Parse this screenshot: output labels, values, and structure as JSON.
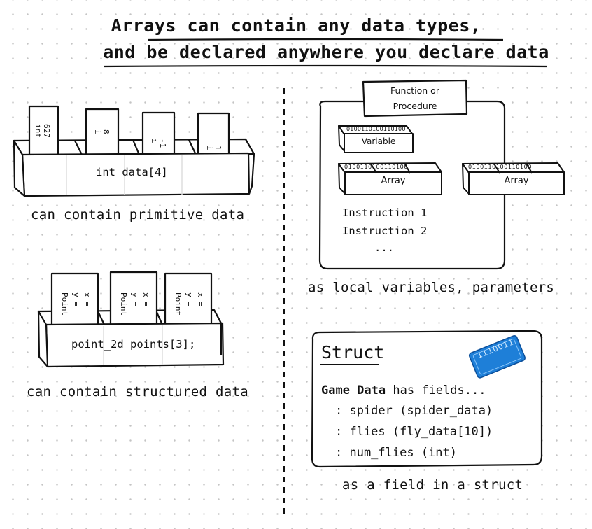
{
  "title": {
    "line1": "Arrays can contain any data types,",
    "line2": "and be declared anywhere you declare data"
  },
  "primitive": {
    "caption": "can contain primitive data",
    "box_label": "int data[4]",
    "slot_texts": [
      "627\nint",
      "8\ni",
      "-1\ni",
      "1\ni"
    ]
  },
  "structured": {
    "caption": "can contain structured data",
    "box_label": "point_2d points[3];",
    "card_lines": [
      "x =",
      "y =",
      "Point"
    ]
  },
  "local": {
    "caption": "as local variables, parameters",
    "function_label_1": "Function or",
    "function_label_2": "Procedure",
    "variable_label": "Variable",
    "array_label": "Array",
    "param_array_label": "Array",
    "bits": "0100110100110100",
    "instructions": [
      "Instruction 1",
      "Instruction 2",
      "..."
    ]
  },
  "struct": {
    "caption": "as a field in a struct",
    "heading": "Struct",
    "owner": "Game Data",
    "has_fields": "has fields...",
    "fields": [
      ": spider (spider_data)",
      ": flies (fly_data[10])",
      ": num_flies (int)"
    ],
    "chip_text": "1110011"
  },
  "colors": {
    "ink": "#111111",
    "chip_blue": "#1e7fd8",
    "dots": "#c4c4c4"
  }
}
